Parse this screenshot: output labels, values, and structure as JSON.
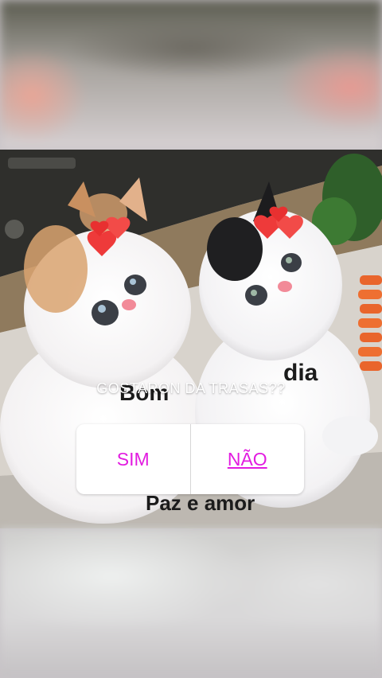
{
  "captions": {
    "bom": "Bom",
    "dia": "dia",
    "paz": "Paz e amor"
  },
  "poll": {
    "question": "GOSTARON  DA  TRASAS??",
    "option_yes": "SIM",
    "option_no": "NÃO"
  },
  "colors": {
    "poll_option_text": "#e21be0",
    "question_text": "#ffffff",
    "poll_background": "#ffffff"
  }
}
